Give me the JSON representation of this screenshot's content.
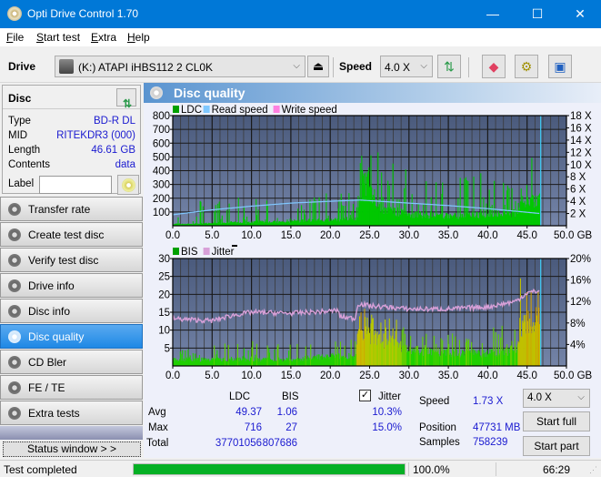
{
  "window": {
    "title": "Opti Drive Control 1.70",
    "minimize": "—",
    "maximize": "☐",
    "close": "✕"
  },
  "menu": {
    "items": [
      {
        "label": "File",
        "mnemonic": "F",
        "rest": "ile"
      },
      {
        "label": "Start test",
        "mnemonic": "S",
        "rest": "tart test"
      },
      {
        "label": "Extra",
        "mnemonic": "E",
        "rest": "xtra"
      },
      {
        "label": "Help",
        "mnemonic": "H",
        "rest": "elp"
      }
    ]
  },
  "toolbar": {
    "drive_label": "Drive",
    "drive_value": "(K:)  ATAPI iHBS112  2 CL0K",
    "eject_icon": "⏏",
    "speed_label": "Speed",
    "speed_value": "4.0 X",
    "chevron": "⌵"
  },
  "disc": {
    "header": "Disc",
    "rows": [
      {
        "key": "Type",
        "value": "BD-R DL"
      },
      {
        "key": "MID",
        "value": "RITEKDR3 (000)"
      },
      {
        "key": "Length",
        "value": "46.61 GB"
      },
      {
        "key": "Contents",
        "value": "data"
      }
    ],
    "label_key": "Label",
    "label_value": ""
  },
  "nav": {
    "items": [
      {
        "label": "Transfer rate",
        "active": false
      },
      {
        "label": "Create test disc",
        "active": false
      },
      {
        "label": "Verify test disc",
        "active": false
      },
      {
        "label": "Drive info",
        "active": false
      },
      {
        "label": "Disc info",
        "active": false
      },
      {
        "label": "Disc quality",
        "active": true
      },
      {
        "label": "CD Bler",
        "active": false
      },
      {
        "label": "FE / TE",
        "active": false
      },
      {
        "label": "Extra tests",
        "active": false
      }
    ],
    "status_window": "Status window > >"
  },
  "panel": {
    "title": "Disc quality"
  },
  "chart_data": [
    {
      "type": "bar",
      "title": "LDC",
      "legend": [
        {
          "name": "LDC",
          "color": "#00a000"
        },
        {
          "name": "Read speed",
          "color": "#80c8ff"
        },
        {
          "name": "Write speed",
          "color": "#ff80e0"
        }
      ],
      "legend_placement": "top-left",
      "xlabel": "GB",
      "x_ticks": [
        "0.0",
        "5.0",
        "10.0",
        "15.0",
        "20.0",
        "25.0",
        "30.0",
        "35.0",
        "40.0",
        "45.0",
        "50.0 GB"
      ],
      "xlim": [
        0,
        50
      ],
      "y_ticks": [
        "800",
        "700",
        "600",
        "500",
        "400",
        "300",
        "200",
        "100"
      ],
      "ylim": [
        0,
        800
      ],
      "y2_ticks": [
        "18 X",
        "16 X",
        "14 X",
        "12 X",
        "10 X",
        "8 X",
        "6 X",
        "4 X",
        "2 X"
      ],
      "y2lim": [
        0,
        18
      ],
      "grid": true,
      "ldc_profile": [
        {
          "x": 0,
          "base": 15,
          "peak": 60
        },
        {
          "x": 2.5,
          "base": 15,
          "peak": 240
        },
        {
          "x": 5,
          "base": 20,
          "peak": 120
        },
        {
          "x": 7,
          "base": 30,
          "peak": 360
        },
        {
          "x": 9,
          "base": 20,
          "peak": 140
        },
        {
          "x": 11,
          "base": 35,
          "peak": 220
        },
        {
          "x": 14,
          "base": 30,
          "peak": 110
        },
        {
          "x": 18,
          "base": 45,
          "peak": 210
        },
        {
          "x": 21,
          "base": 50,
          "peak": 300
        },
        {
          "x": 23.5,
          "base": 60,
          "peak": 240
        },
        {
          "x": 24,
          "base": 400,
          "peak": 716
        },
        {
          "x": 25,
          "base": 300,
          "peak": 600
        },
        {
          "x": 26.5,
          "base": 140,
          "peak": 560
        },
        {
          "x": 30,
          "base": 90,
          "peak": 400
        },
        {
          "x": 35,
          "base": 80,
          "peak": 340
        },
        {
          "x": 40,
          "base": 90,
          "peak": 400
        },
        {
          "x": 43.5,
          "base": 100,
          "peak": 260
        },
        {
          "x": 44,
          "base": 180,
          "peak": 500
        },
        {
          "x": 46,
          "base": 200,
          "peak": 560
        },
        {
          "x": 46.6,
          "base": 200,
          "peak": 650
        }
      ],
      "read_speed": [
        {
          "x": 0,
          "y": 1.8
        },
        {
          "x": 5,
          "y": 2.6
        },
        {
          "x": 10,
          "y": 3.2
        },
        {
          "x": 15,
          "y": 3.7
        },
        {
          "x": 20,
          "y": 4.0
        },
        {
          "x": 23.8,
          "y": 4.2
        },
        {
          "x": 25,
          "y": 4.1
        },
        {
          "x": 30,
          "y": 3.7
        },
        {
          "x": 35,
          "y": 3.3
        },
        {
          "x": 40,
          "y": 2.8
        },
        {
          "x": 45,
          "y": 2.2
        },
        {
          "x": 46.6,
          "y": 2.0
        }
      ],
      "end_marker_x": 46.61
    },
    {
      "type": "bar",
      "title": "BIS / Jitter",
      "legend": [
        {
          "name": "BIS",
          "color": "#00a000"
        },
        {
          "name": "Jitter",
          "color": "#d8a0d8"
        }
      ],
      "legend_placement": "top-left",
      "xlabel": "GB",
      "x_ticks": [
        "0.0",
        "5.0",
        "10.0",
        "15.0",
        "20.0",
        "25.0",
        "30.0",
        "35.0",
        "40.0",
        "45.0",
        "50.0 GB"
      ],
      "xlim": [
        0,
        50
      ],
      "y_ticks": [
        "30",
        "25",
        "20",
        "15",
        "10",
        "5"
      ],
      "ylim": [
        0,
        30
      ],
      "y2_ticks": [
        "20%",
        "16%",
        "12%",
        "8%",
        "4%"
      ],
      "y2lim": [
        0,
        20
      ],
      "grid": true,
      "bis_profile": [
        {
          "x": 0,
          "base": 2,
          "peak": 4
        },
        {
          "x": 5,
          "base": 2,
          "peak": 6
        },
        {
          "x": 10,
          "base": 2,
          "peak": 7
        },
        {
          "x": 15,
          "base": 2,
          "peak": 6
        },
        {
          "x": 20,
          "base": 3,
          "peak": 7
        },
        {
          "x": 23.2,
          "base": 3,
          "peak": 8
        },
        {
          "x": 23.5,
          "base": 12,
          "peak": 27
        },
        {
          "x": 25,
          "base": 10,
          "peak": 16
        },
        {
          "x": 28,
          "base": 7,
          "peak": 14
        },
        {
          "x": 30,
          "base": 5,
          "peak": 9
        },
        {
          "x": 35,
          "base": 4,
          "peak": 9
        },
        {
          "x": 40,
          "base": 4,
          "peak": 12
        },
        {
          "x": 43.5,
          "base": 5,
          "peak": 12
        },
        {
          "x": 44,
          "base": 12,
          "peak": 25
        },
        {
          "x": 46.6,
          "base": 12,
          "peak": 22
        }
      ],
      "jitter": [
        {
          "x": 0,
          "y": 8.8
        },
        {
          "x": 2.5,
          "y": 8.6
        },
        {
          "x": 5,
          "y": 8.4
        },
        {
          "x": 7.5,
          "y": 9.4
        },
        {
          "x": 10,
          "y": 10.0
        },
        {
          "x": 15,
          "y": 9.8
        },
        {
          "x": 20,
          "y": 10.2
        },
        {
          "x": 21,
          "y": 10.4
        },
        {
          "x": 21.2,
          "y": 9.2
        },
        {
          "x": 23.2,
          "y": 8.8
        },
        {
          "x": 23.5,
          "y": 11.6
        },
        {
          "x": 25,
          "y": 11.2
        },
        {
          "x": 30,
          "y": 10.6
        },
        {
          "x": 35,
          "y": 10.6
        },
        {
          "x": 40,
          "y": 11.0
        },
        {
          "x": 43.5,
          "y": 12.0
        },
        {
          "x": 45,
          "y": 13.6
        },
        {
          "x": 46.6,
          "y": 14.0
        }
      ],
      "end_marker_x": 46.61
    }
  ],
  "stats": {
    "col_ldc": "LDC",
    "col_bis": "BIS",
    "jitter_label": "Jitter",
    "jitter_checked": true,
    "rows": [
      {
        "label": "Avg",
        "ldc": "49.37",
        "bis": "1.06",
        "jitter": "10.3%"
      },
      {
        "label": "Max",
        "ldc": "716",
        "bis": "27",
        "jitter": "15.0%"
      },
      {
        "label": "Total",
        "ldc": "37701056",
        "bis": "807686",
        "jitter": ""
      }
    ],
    "speed_label": "Speed",
    "speed_value": "1.73 X",
    "position_label": "Position",
    "position_value": "47731 MB",
    "samples_label": "Samples",
    "samples_value": "758239",
    "speed_select": "4.0 X",
    "start_full": "Start full",
    "start_part": "Start part"
  },
  "statusbar": {
    "message": "Test completed",
    "progress_percent": 100,
    "progress_text": "100.0%",
    "elapsed": "66:29"
  }
}
